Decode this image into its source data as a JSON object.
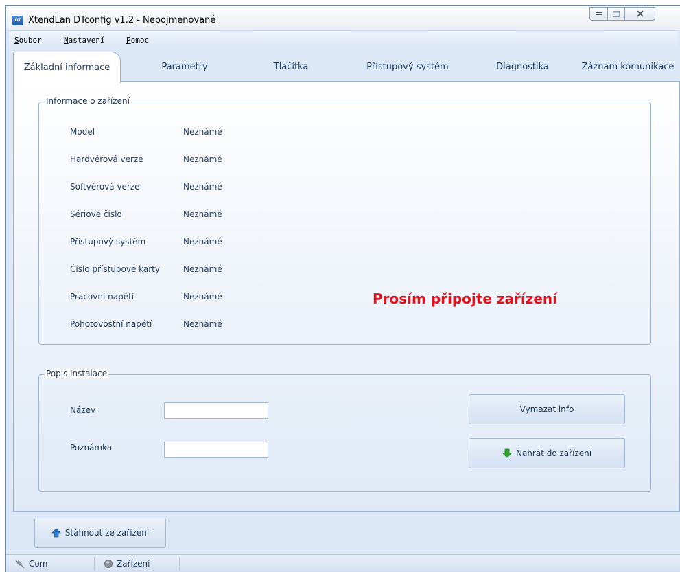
{
  "window": {
    "icon_text": "DT",
    "title": "XtendLan DTconfig v1.2 - Nepojmenované"
  },
  "menu": [
    {
      "accel": "S",
      "rest": "oubor"
    },
    {
      "accel": "N",
      "rest": "astavení"
    },
    {
      "accel": "P",
      "rest": "omoc"
    }
  ],
  "tabs": [
    {
      "label": "Základní informace",
      "active": true
    },
    {
      "label": "Parametry",
      "active": false
    },
    {
      "label": "Tlačítka",
      "active": false
    },
    {
      "label": "Přístupový systém",
      "active": false
    },
    {
      "label": "Diagnostika",
      "active": false
    },
    {
      "label": "Záznam komunikace",
      "active": false
    }
  ],
  "device_info": {
    "title": "Informace o zařízení",
    "rows": [
      {
        "label": "Model",
        "value": "Neznámé"
      },
      {
        "label": "Hardvérová verze",
        "value": "Neznámé"
      },
      {
        "label": "Softvérová verze",
        "value": "Neznámé"
      },
      {
        "label": "Sériové číslo",
        "value": "Neznámé"
      },
      {
        "label": "Přístupový systém",
        "value": "Neznámé"
      },
      {
        "label": "Číslo přístupové karty",
        "value": "Neznámé"
      },
      {
        "label": "Pracovní napětí",
        "value": "Neznámé"
      },
      {
        "label": "Pohotovostní napětí",
        "value": "Neznámé"
      }
    ],
    "warning": "Prosím připojte zařízení"
  },
  "installation": {
    "title": "Popis instalace",
    "name_label": "Název",
    "name_value": "",
    "note_label": "Poznámka",
    "note_value": "",
    "clear_button": "Vymazat info",
    "upload_button": "Nahrát do zařízení"
  },
  "download_button": "Stáhnout ze zařízení",
  "status": {
    "com": "Com",
    "device": "Zařízení"
  },
  "colors": {
    "warning": "#e5101a",
    "text": "#1e395b",
    "upload_arrow": "#2fa82f",
    "download_arrow": "#2a7fd4"
  }
}
